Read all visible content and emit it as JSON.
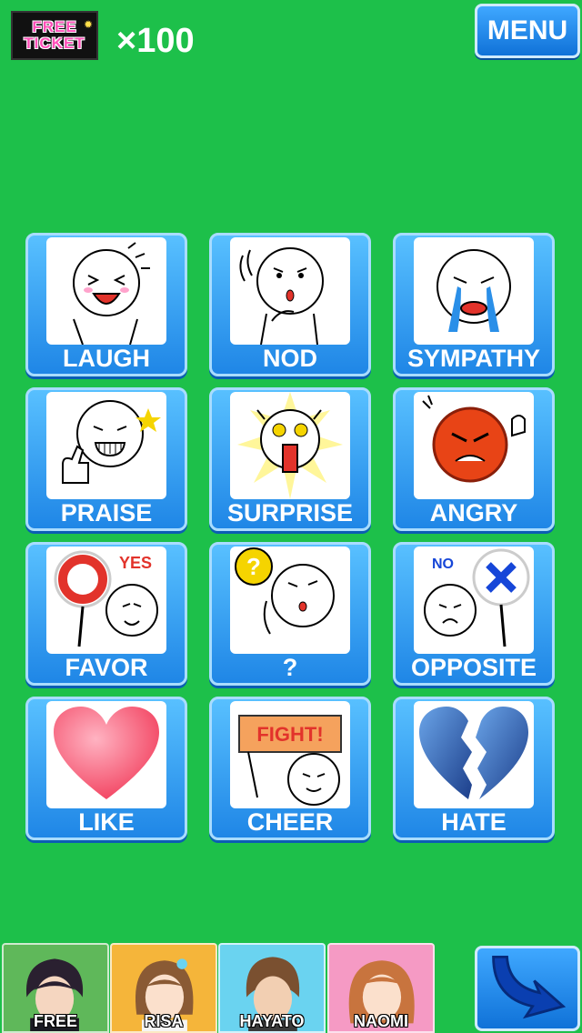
{
  "header": {
    "ticket_line1": "FREE",
    "ticket_line2": "TICKET",
    "ticket_count": "×100",
    "menu_label": "MENU"
  },
  "reactions": [
    {
      "label": "LAUGH",
      "icon": "laugh-face-icon"
    },
    {
      "label": "NOD",
      "icon": "nod-face-icon"
    },
    {
      "label": "SYMPATHY",
      "icon": "crying-face-icon"
    },
    {
      "label": "PRAISE",
      "icon": "thumbs-up-face-icon"
    },
    {
      "label": "SURPRISE",
      "icon": "surprised-face-icon"
    },
    {
      "label": "ANGRY",
      "icon": "angry-face-icon"
    },
    {
      "label": "FAVOR",
      "icon": "yes-circle-sign-icon",
      "sign_text": "YES"
    },
    {
      "label": "?",
      "icon": "question-face-icon",
      "sign_text": "?"
    },
    {
      "label": "OPPOSITE",
      "icon": "no-cross-sign-icon",
      "sign_text": "NO"
    },
    {
      "label": "LIKE",
      "icon": "heart-icon"
    },
    {
      "label": "CHEER",
      "icon": "fight-sign-icon",
      "sign_text": "FIGHT!"
    },
    {
      "label": "HATE",
      "icon": "broken-heart-icon"
    }
  ],
  "characters": [
    {
      "name": "FREE",
      "bg": "#5fb85a"
    },
    {
      "name": "RISA",
      "bg": "#f5b53a"
    },
    {
      "name": "HAYATO",
      "bg": "#6ad3f0"
    },
    {
      "name": "NAOMI",
      "bg": "#f59ac4"
    }
  ],
  "next_button": {
    "icon": "curved-arrow-down-right-icon"
  },
  "colors": {
    "background": "#1dc04a",
    "button_blue": "#1f86e6"
  }
}
